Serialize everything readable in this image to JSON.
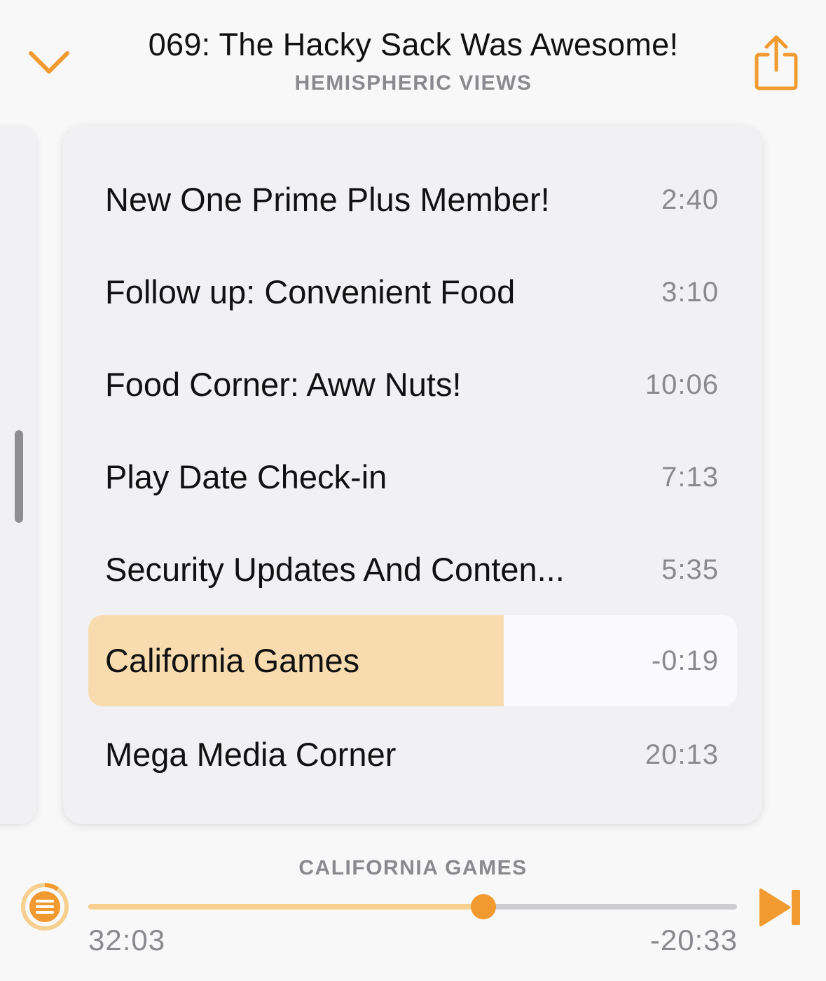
{
  "colors": {
    "accent": "#f09a30",
    "highlight": "#f8dcb0",
    "secondary_text": "#8a8a8e"
  },
  "header": {
    "episode_title": "069: The Hacky Sack Was Awesome!",
    "show_name": "HEMISPHERIC VIEWS",
    "collapse_icon": "chevron-down-icon",
    "share_icon": "share-icon"
  },
  "chapters": [
    {
      "title": "New One Prime Plus Member!",
      "time": "2:40"
    },
    {
      "title": "Follow up: Convenient Food",
      "time": "3:10"
    },
    {
      "title": "Food Corner: Aww Nuts!",
      "time": "10:06"
    },
    {
      "title": "Play Date Check-in",
      "time": "7:13"
    },
    {
      "title": "Security Updates And Conten...",
      "time": "5:35"
    },
    {
      "title": "California Games",
      "time": "-0:19",
      "current": true,
      "progress": 0.64
    },
    {
      "title": "Mega Media Corner",
      "time": "20:13"
    }
  ],
  "player": {
    "current_chapter": "CALIFORNIA GAMES",
    "elapsed": "32:03",
    "remaining": "-20:33",
    "progress": 0.609,
    "list_icon": "chapters-list-icon",
    "next_icon": "next-chapter-icon"
  }
}
